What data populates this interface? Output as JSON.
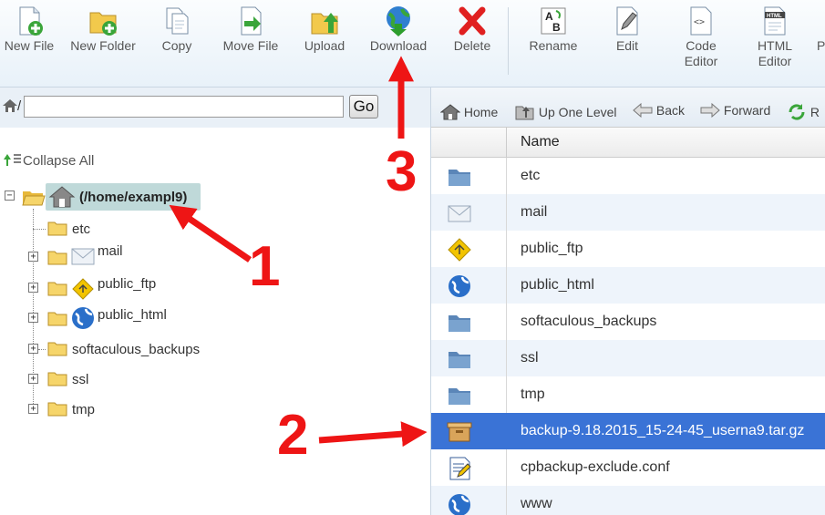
{
  "toolbar": {
    "new_file": "New File",
    "new_folder": "New Folder",
    "copy": "Copy",
    "move_file": "Move File",
    "upload": "Upload",
    "download": "Download",
    "delete": "Delete",
    "rename": "Rename",
    "edit": "Edit",
    "code_editor_1": "Code",
    "code_editor_2": "Editor",
    "html_editor_1": "HTML",
    "html_editor_2": "Editor",
    "perm_partial": "P"
  },
  "pathbar": {
    "prefix": "/",
    "value": "",
    "go": "Go"
  },
  "tree": {
    "collapse_all": "Collapse All",
    "root": "(/home/exampl9)",
    "items": [
      {
        "label": "etc",
        "icon": "folder-icon"
      },
      {
        "label": "mail",
        "icon": "mail-icon"
      },
      {
        "label": "public_ftp",
        "icon": "ftp-icon"
      },
      {
        "label": "public_html",
        "icon": "globe-icon"
      },
      {
        "label": "softaculous_backups",
        "icon": "folder-icon"
      },
      {
        "label": "ssl",
        "icon": "folder-icon"
      },
      {
        "label": "tmp",
        "icon": "folder-icon"
      }
    ]
  },
  "navbar": {
    "home": "Home",
    "up": "Up One Level",
    "back": "Back",
    "forward": "Forward",
    "reload_partial": "R"
  },
  "files": {
    "header": "Name",
    "rows": [
      {
        "name": "etc",
        "icon": "folder-icon"
      },
      {
        "name": "mail",
        "icon": "mail-icon"
      },
      {
        "name": "public_ftp",
        "icon": "ftp-icon"
      },
      {
        "name": "public_html",
        "icon": "globe-icon"
      },
      {
        "name": "softaculous_backups",
        "icon": "folder-icon"
      },
      {
        "name": "ssl",
        "icon": "folder-icon"
      },
      {
        "name": "tmp",
        "icon": "folder-icon"
      },
      {
        "name": "backup-9.18.2015_15-24-45_userna9.tar.gz",
        "icon": "archive-icon",
        "selected": true
      },
      {
        "name": "cpbackup-exclude.conf",
        "icon": "config-file-icon"
      },
      {
        "name": "www",
        "icon": "globe-icon"
      }
    ]
  },
  "annotations": {
    "step1": "1",
    "step2": "2",
    "step3": "3"
  },
  "colors": {
    "annotation": "#ee1515",
    "selected_row": "#3a73d6",
    "root_highlight": "#bfd9d9"
  }
}
